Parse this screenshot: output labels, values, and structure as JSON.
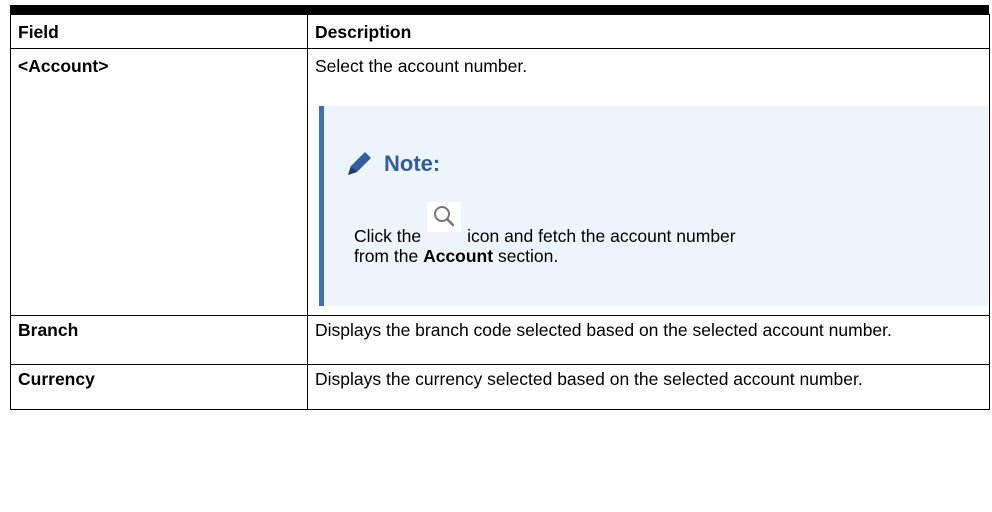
{
  "table": {
    "headers": [
      "Field",
      "Description"
    ],
    "rows": [
      {
        "field": "<Account>",
        "description": "Select the account number.",
        "note": {
          "title": "Note:",
          "text_before_icon": "Click the",
          "text_after_icon": "icon and fetch the account number",
          "line2_prefix": "from the",
          "line2_bold": "Account",
          "line2_suffix": "section.",
          "icon": "search-icon"
        }
      },
      {
        "field": "Branch",
        "description": "Displays the branch code selected based on the selected account number."
      },
      {
        "field": "Currency",
        "description": "Displays the currency selected based on the selected account number."
      }
    ]
  },
  "colors": {
    "note_background": "#eef4fb",
    "note_accent": "#3a72b8",
    "note_title": "#2f5f9e"
  }
}
